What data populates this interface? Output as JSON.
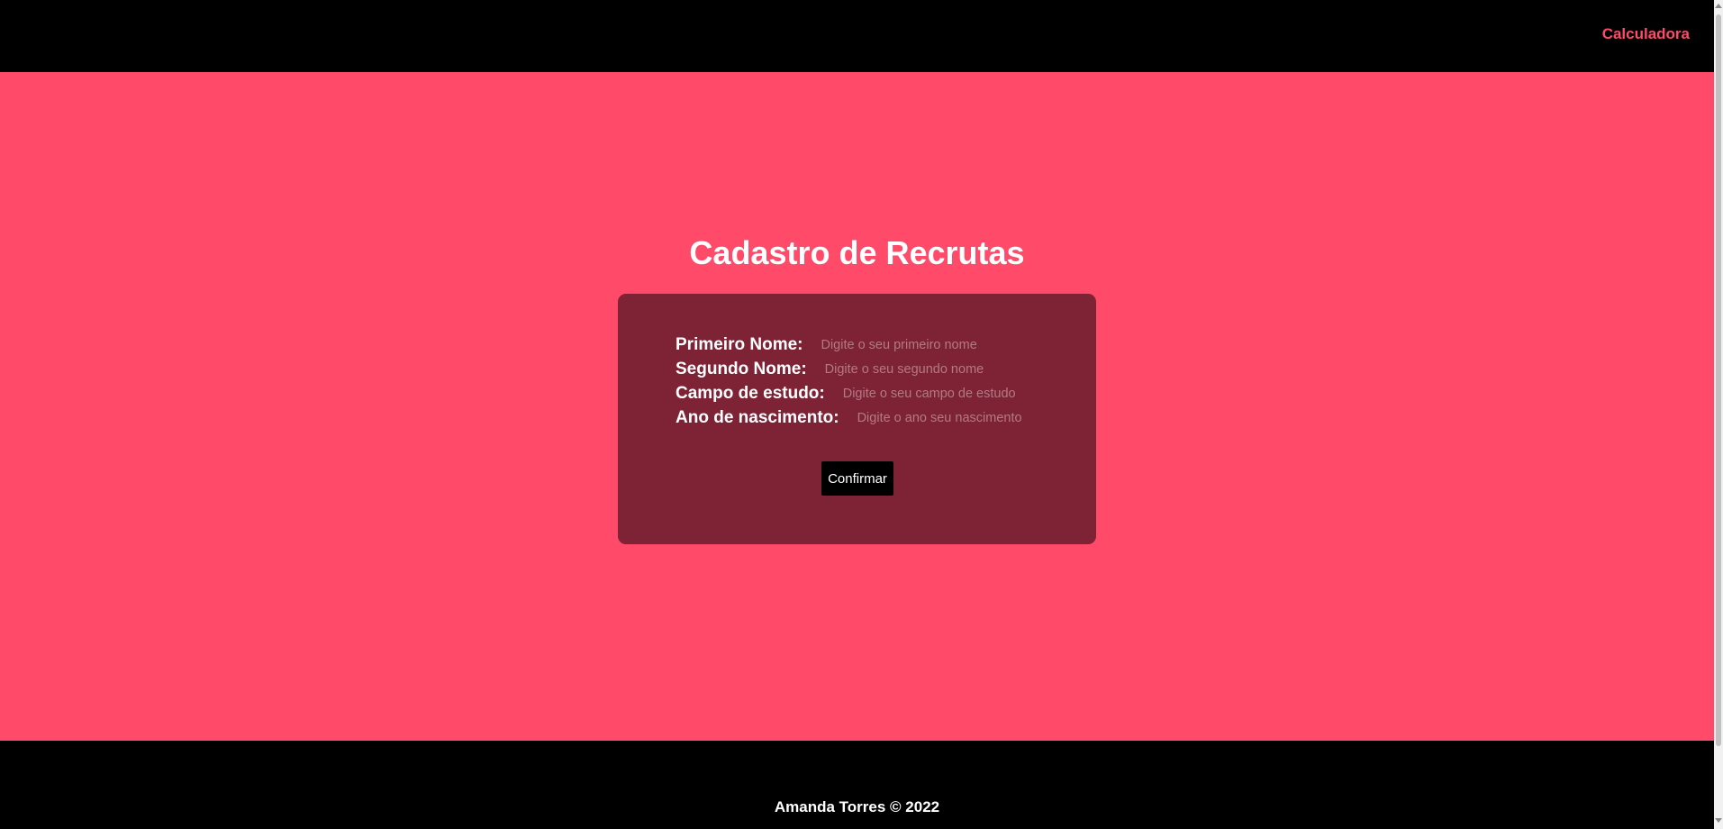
{
  "nav": {
    "link_label": "Calculadora"
  },
  "main": {
    "title": "Cadastro de Recrutas"
  },
  "form": {
    "fields": [
      {
        "label": "Primeiro Nome:",
        "placeholder": "Digite o seu primeiro nome",
        "value": ""
      },
      {
        "label": "Segundo Nome:",
        "placeholder": "Digite o seu segundo nome",
        "value": ""
      },
      {
        "label": "Campo de estudo:",
        "placeholder": "Digite o seu campo de estudo",
        "value": ""
      },
      {
        "label": "Ano de nascimento:",
        "placeholder": "Digite o ano seu nascimento",
        "value": ""
      }
    ],
    "submit_label": "Confirmar"
  },
  "footer": {
    "text": "Amanda Torres © 2022"
  },
  "colors": {
    "header_bg": "#000000",
    "page_bg": "#ff4a6a",
    "card_bg": "#7d2335",
    "accent": "#ff4a6a",
    "button_bg": "#000000",
    "text": "#ffffff"
  }
}
